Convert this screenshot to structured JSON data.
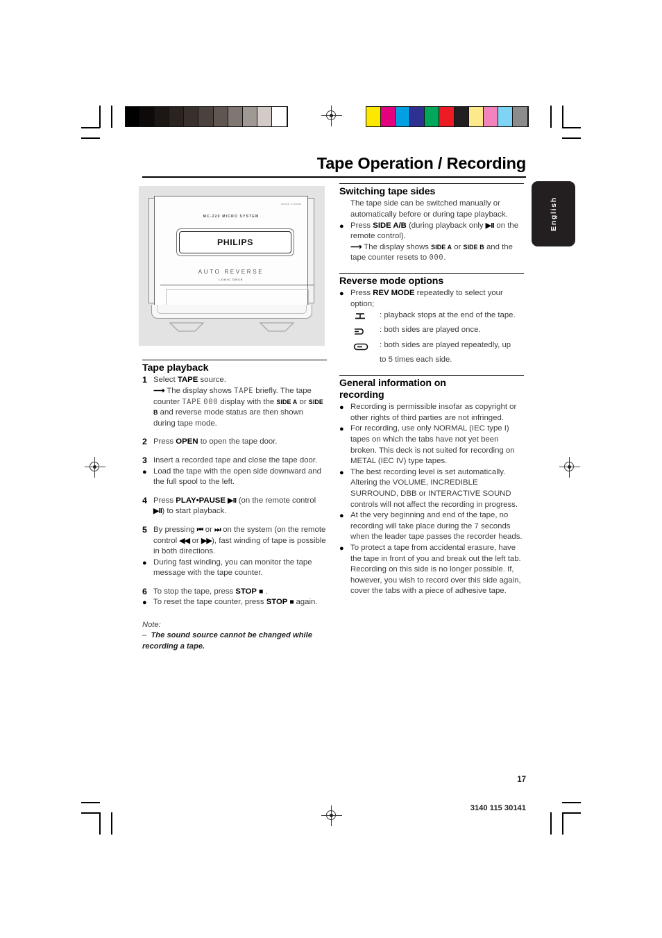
{
  "document": {
    "title": "Tape Operation / Recording",
    "language_tab": "English",
    "page_number": "17",
    "part_number": "3140 115 30141"
  },
  "figure": {
    "model_label": "MC-220 MICRO SYSTEM",
    "micro_mark": "MICRO SYSTEM",
    "brand": "PHILIPS",
    "auto_reverse": "AUTO REVERSE",
    "logic_deck": "LOGIC DECK"
  },
  "color_bars": {
    "grayscale": [
      "#000000",
      "#0d0a09",
      "#1c1715",
      "#2a2320",
      "#38302c",
      "#4b423e",
      "#5f5651",
      "#807772",
      "#a09893",
      "#d2cbc8",
      "#ffffff"
    ],
    "process": [
      "#ffe800",
      "#e5007e",
      "#00a0e3",
      "#2e3192",
      "#00a65a",
      "#ed1c24",
      "#231f20",
      "#fbe98b",
      "#f283bd",
      "#7fd4f5",
      "#8c8c8c"
    ]
  },
  "left_column": {
    "section_title": "Tape playback",
    "steps": [
      {
        "mark": "1",
        "lines": [
          "Select TAPE source.",
          "The display shows TAPE briefly. The tape counter TAPE 000 display with the SIDE A or SIDE B and reverse mode status are then shown during tape mode."
        ]
      },
      {
        "mark": "2",
        "lines": [
          "Press OPEN to open the tape door."
        ]
      },
      {
        "mark": "3",
        "lines": [
          "Insert a recorded tape and close the tape door."
        ]
      },
      {
        "mark": "●",
        "lines": [
          "Load the tape with the open side downward and the full spool to the left."
        ]
      },
      {
        "mark": "4",
        "lines": [
          "Press PLAY•PAUSE ▶II (on the remote control ▶II) to start playback."
        ]
      },
      {
        "mark": "5",
        "lines": [
          "By pressing |◀◀ or ▶▶| on the system (on the remote control ◀◀ or ▶▶), fast winding of tape is possible in both directions."
        ]
      },
      {
        "mark": "●",
        "lines": [
          "During fast winding, you can monitor the tape message with the tape counter."
        ]
      },
      {
        "mark": "6",
        "lines": [
          "To stop the tape, press STOP ■ ."
        ]
      },
      {
        "mark": "●",
        "lines": [
          "To reset the tape counter, press STOP ■ again."
        ]
      }
    ],
    "note": {
      "heading": "Note:",
      "dash": "–",
      "text": "The sound source cannot be changed while recording a tape."
    },
    "lcd": {
      "tape": "TAPE",
      "counter": "000"
    },
    "keys": {
      "tape": "TAPE",
      "open": "OPEN",
      "play_pause": "PLAY•PAUSE",
      "stop": "STOP",
      "side_a": "SIDE A",
      "side_b": "SIDE B"
    }
  },
  "right_column": {
    "switching": {
      "title": "Switching tape sides",
      "intro": "The tape side can be switched manually or automatically before or during tape playback.",
      "bullet": "Press SIDE A/B (during playback only ▶II on the remote control).",
      "arrow_line": "The display shows SIDE A or SIDE B and the tape counter resets to 000.",
      "key_side_ab": "SIDE A/B",
      "side_a": "SIDE A",
      "side_b": "SIDE B",
      "counter": "000"
    },
    "reverse": {
      "title": "Reverse mode options",
      "bullet": "Press REV MODE repeatedly to select your option;",
      "key_rev_mode": "REV MODE",
      "options": [
        {
          "symbol": "tape-stop-icon",
          "text": ": playback stops at the end of the tape."
        },
        {
          "symbol": "play-both-once-icon",
          "text": ": both sides are played once."
        },
        {
          "symbol": "play-both-repeat-icon",
          "text": ": both sides are played repeatedly, up"
        }
      ],
      "options_continuation": "to 5 times each side."
    },
    "general": {
      "title_line1": "General information on",
      "title_line2": "recording",
      "bullets": [
        "Recording is permissible insofar as copyright or other rights of third parties are not infringed.",
        "For recording, use only NORMAL (IEC type I) tapes on which the tabs have not yet been broken. This deck is not suited for recording on METAL (IEC IV) type tapes.",
        "The best recording level is set automatically. Altering the VOLUME, INCREDIBLE SURROUND, DBB or INTERACTIVE SOUND controls will not affect the recording in progress.",
        "At the very beginning and end of the tape, no recording will take place during the 7 seconds when the leader tape passes the recorder heads.",
        "To protect a tape from accidental erasure, have the tape in front of you and break out the left tab. Recording on this side is no longer possible. If, however, you wish to record over this side again, cover the tabs with a piece of adhesive tape."
      ]
    }
  }
}
